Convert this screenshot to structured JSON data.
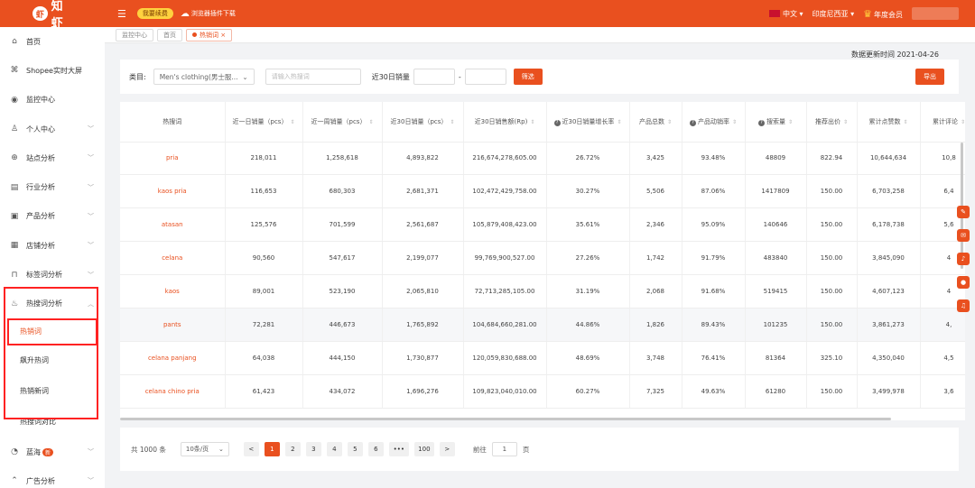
{
  "topbar": {
    "logo_text": "知虾",
    "logo_mark": "虾",
    "btn_yellow": "我要续费",
    "plugin_download": "浏览器插件下载",
    "language": "中文",
    "region": "印度尼西亚",
    "membership": "年度会员"
  },
  "sidebar": {
    "items": [
      {
        "icon": "home-icon",
        "glyph": "⌂",
        "label": "首页"
      },
      {
        "icon": "screen-icon",
        "glyph": "⌘",
        "label": "Shopee实时大屏"
      },
      {
        "icon": "monitor-icon",
        "glyph": "◉",
        "label": "监控中心"
      },
      {
        "icon": "person-icon",
        "glyph": "♙",
        "label": "个人中心"
      },
      {
        "icon": "globe-icon",
        "glyph": "⊕",
        "label": "站点分析"
      },
      {
        "icon": "industry-icon",
        "glyph": "▤",
        "label": "行业分析"
      },
      {
        "icon": "box-icon",
        "glyph": "▣",
        "label": "产品分析"
      },
      {
        "icon": "store-icon",
        "glyph": "▦",
        "label": "店铺分析"
      },
      {
        "icon": "tag-icon",
        "glyph": "⊓",
        "label": "标签词分析"
      },
      {
        "icon": "fire-icon",
        "glyph": "♨",
        "label": "热搜词分析"
      }
    ],
    "sub_items": [
      "热销词",
      "飙升热词",
      "热销新词",
      "热搜词对比"
    ],
    "bottom_items": [
      {
        "icon": "bluesea-icon",
        "glyph": "◔",
        "label": "蓝海",
        "badge": "新"
      },
      {
        "icon": "ad-icon",
        "glyph": "⌃",
        "label": "广告分析"
      }
    ]
  },
  "breadcrumb": [
    "监控中心",
    "首页",
    "热销词"
  ],
  "update_time": "数据更新时间 2021-04-26",
  "filter": {
    "category_label": "类目:",
    "category_value": "Men's clothing(男士服...",
    "keyword_placeholder": "请输入热搜词",
    "sales_label": "近30日销量",
    "range_sep": "-",
    "filter_btn": "筛选",
    "export_btn": "导出"
  },
  "table": {
    "headers": [
      "热搜词",
      "近一日销量（pcs）",
      "近一周销量（pcs）",
      "近30日销量（pcs）",
      "近30日销售额(Rp)",
      "近30日销量增长率",
      "产品总数",
      "产品动销率",
      "搜索量",
      "推荐出价",
      "累计点赞数",
      "累计评论"
    ],
    "rows": [
      [
        "pria",
        "218,011",
        "1,258,618",
        "4,893,822",
        "216,674,278,605.00",
        "26.72%",
        "3,425",
        "93.48%",
        "48809",
        "822.94",
        "10,644,634",
        "10,8"
      ],
      [
        "kaos pria",
        "116,653",
        "680,303",
        "2,681,371",
        "102,472,429,758.00",
        "30.27%",
        "5,506",
        "87.06%",
        "1417809",
        "150.00",
        "6,703,258",
        "6,4"
      ],
      [
        "atasan",
        "125,576",
        "701,599",
        "2,561,687",
        "105,879,408,423.00",
        "35.61%",
        "2,346",
        "95.09%",
        "140646",
        "150.00",
        "6,178,738",
        "5,6"
      ],
      [
        "celana",
        "90,560",
        "547,617",
        "2,199,077",
        "99,769,900,527.00",
        "27.26%",
        "1,742",
        "91.79%",
        "483840",
        "150.00",
        "3,845,090",
        "4"
      ],
      [
        "kaos",
        "89,001",
        "523,190",
        "2,065,810",
        "72,713,285,105.00",
        "31.19%",
        "2,068",
        "91.68%",
        "519415",
        "150.00",
        "4,607,123",
        "4"
      ],
      [
        "pants",
        "72,281",
        "446,673",
        "1,765,892",
        "104,684,660,281.00",
        "44.86%",
        "1,826",
        "89.43%",
        "101235",
        "150.00",
        "3,861,273",
        "4,"
      ],
      [
        "celana panjang",
        "64,038",
        "444,150",
        "1,730,877",
        "120,059,830,688.00",
        "48.69%",
        "3,748",
        "76.41%",
        "81364",
        "325.10",
        "4,350,040",
        "4,5"
      ],
      [
        "celana chino pria",
        "61,423",
        "434,072",
        "1,696,276",
        "109,823,040,010.00",
        "60.27%",
        "7,325",
        "49.63%",
        "61280",
        "150.00",
        "3,499,978",
        "3,6"
      ]
    ]
  },
  "pager": {
    "total": "共 1000 条",
    "page_size": "10条/页",
    "prev": "<",
    "pages": [
      "1",
      "2",
      "3",
      "4",
      "5",
      "6",
      "•••",
      "100"
    ],
    "next": ">",
    "goto_label": "前往",
    "goto_value": "1",
    "page_unit": "页"
  },
  "colors": {
    "brand": "#e9501f",
    "highlight": "#ff2222"
  }
}
